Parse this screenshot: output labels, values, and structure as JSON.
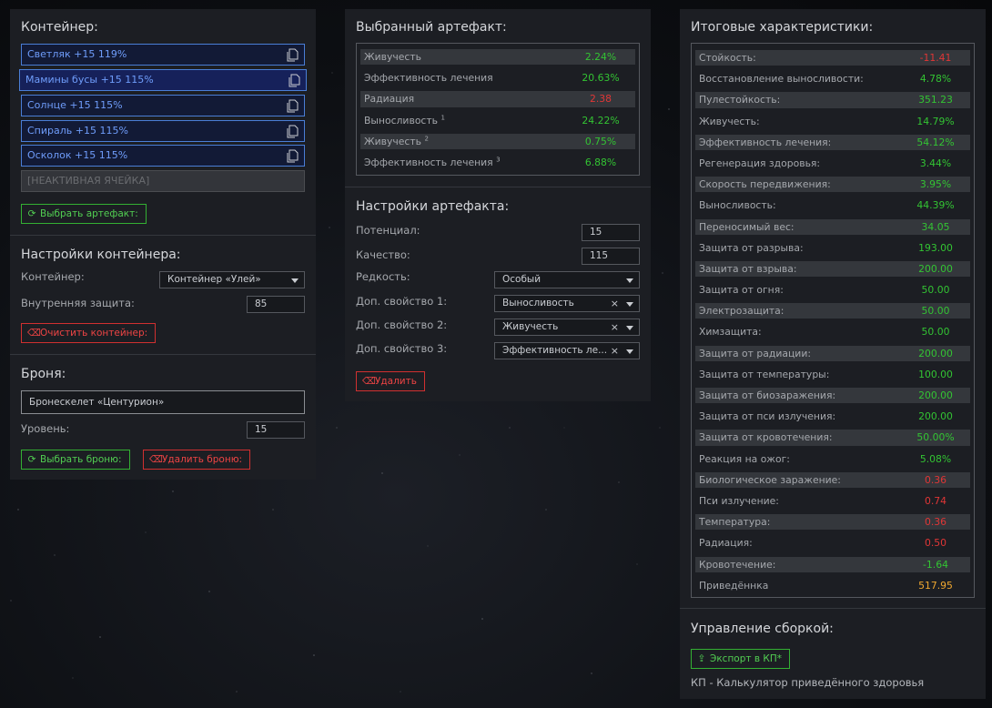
{
  "colors": {
    "green": "#33c433",
    "red": "#e03636",
    "orange": "#f0a830",
    "accent_blue": "#6f9dfb",
    "panel_bg": "#1c1e23"
  },
  "container_panel": {
    "title": "Контейнер:",
    "slots": [
      {
        "label": "Светляк +15 119%",
        "icon": "copy-icon"
      },
      {
        "label": "Мамины бусы +15 115%",
        "icon": "copy-icon"
      },
      {
        "label": "Солнце +15 115%",
        "icon": "copy-icon"
      },
      {
        "label": "Спираль +15 115%",
        "icon": "copy-icon"
      },
      {
        "label": "Осколок +15 115%",
        "icon": "copy-icon"
      }
    ],
    "inactive_slot": "[НЕАКТИВНАЯ ЯЧЕЙКА]",
    "select_artifact_button": "Выбрать артефакт:",
    "settings_title": "Настройки контейнера:",
    "container_label": "Контейнер:",
    "container_value": "Контейнер «Улей»",
    "protection_label": "Внутренняя защита:",
    "protection_value": "85",
    "clear_button": "Очистить контейнер:"
  },
  "armor_panel": {
    "title": "Броня:",
    "armor_value": "Бронескелет «Центурион»",
    "level_label": "Уровень:",
    "level_value": "15",
    "select_button": "Выбрать броню:",
    "delete_button": "Удалить броню:"
  },
  "artifact_panel": {
    "title": "Выбранный артефакт:",
    "stats": [
      {
        "name": "Живучесть",
        "sup": "",
        "value": "2.24%",
        "color": "g"
      },
      {
        "name": "Эффективность лечения",
        "sup": "",
        "value": "20.63%",
        "color": "g"
      },
      {
        "name": "Радиация",
        "sup": "",
        "value": "2.38",
        "color": "r"
      },
      {
        "name": "Выносливость",
        "sup": "1",
        "value": "24.22%",
        "color": "g"
      },
      {
        "name": "Живучесть",
        "sup": "2",
        "value": "0.75%",
        "color": "g"
      },
      {
        "name": "Эффективность лечения",
        "sup": "3",
        "value": "6.88%",
        "color": "g"
      }
    ],
    "settings_title": "Настройки артефакта:",
    "potential_label": "Потенциал:",
    "potential_value": "15",
    "quality_label": "Качество:",
    "quality_value": "115",
    "rarity_label": "Редкость:",
    "rarity_value": "Особый",
    "extra1_label": "Доп. свойство 1:",
    "extra1_value": "Выносливость",
    "extra2_label": "Доп. свойство 2:",
    "extra2_value": "Живучесть",
    "extra3_label": "Доп. свойство 3:",
    "extra3_value": "Эффективность ле...",
    "clear_glyph": "×",
    "delete_button": "Удалить"
  },
  "totals_panel": {
    "title": "Итоговые характеристики:",
    "stats": [
      {
        "name": "Стойкость:",
        "value": "-11.41",
        "color": "r"
      },
      {
        "name": "Восстановление выносливости:",
        "value": "4.78%",
        "color": "g"
      },
      {
        "name": "Пулестойкость:",
        "value": "351.23",
        "color": "g"
      },
      {
        "name": "Живучесть:",
        "value": "14.79%",
        "color": "g"
      },
      {
        "name": "Эффективность лечения:",
        "value": "54.12%",
        "color": "g"
      },
      {
        "name": "Регенерация здоровья:",
        "value": "3.44%",
        "color": "g"
      },
      {
        "name": "Скорость передвижения:",
        "value": "3.95%",
        "color": "g"
      },
      {
        "name": "Выносливость:",
        "value": "44.39%",
        "color": "g"
      },
      {
        "name": "Переносимый вес:",
        "value": "34.05",
        "color": "g"
      },
      {
        "name": "Защита от разрыва:",
        "value": "193.00",
        "color": "g"
      },
      {
        "name": "Защита от взрыва:",
        "value": "200.00",
        "color": "g"
      },
      {
        "name": "Защита от огня:",
        "value": "50.00",
        "color": "g"
      },
      {
        "name": "Электрозащита:",
        "value": "50.00",
        "color": "g"
      },
      {
        "name": "Химзащита:",
        "value": "50.00",
        "color": "g"
      },
      {
        "name": "Защита от радиации:",
        "value": "200.00",
        "color": "g"
      },
      {
        "name": "Защита от температуры:",
        "value": "100.00",
        "color": "g"
      },
      {
        "name": "Защита от биозаражения:",
        "value": "200.00",
        "color": "g"
      },
      {
        "name": "Защита от пси излучения:",
        "value": "200.00",
        "color": "g"
      },
      {
        "name": "Защита от кровотечения:",
        "value": "50.00%",
        "color": "g"
      },
      {
        "name": "Реакция на ожог:",
        "value": "5.08%",
        "color": "g"
      },
      {
        "name": "Биологическое заражение:",
        "value": "0.36",
        "color": "r"
      },
      {
        "name": "Пси излучение:",
        "value": "0.74",
        "color": "r"
      },
      {
        "name": "Температура:",
        "value": "0.36",
        "color": "r"
      },
      {
        "name": "Радиация:",
        "value": "0.50",
        "color": "r"
      },
      {
        "name": "Кровотечение:",
        "value": "-1.64",
        "color": "g"
      },
      {
        "name": "Приведённка",
        "value": "517.95",
        "color": "o"
      }
    ],
    "build_title": "Управление сборкой:",
    "export_button": "Экспорт в КП*",
    "footnote": "КП - Калькулятор приведённого здоровья"
  }
}
